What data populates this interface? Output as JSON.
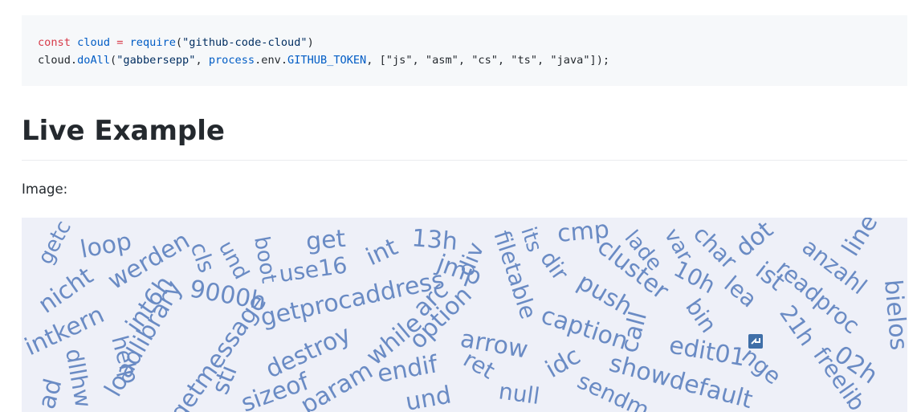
{
  "code": {
    "line1": {
      "kw": "const",
      "var": "cloud",
      "op": "=",
      "fn": "require",
      "open": "(",
      "str": "\"github-code-cloud\"",
      "close": ")"
    },
    "line2": {
      "obj": "cloud",
      "dot": ".",
      "fn": "doAll",
      "open": "(",
      "arg1": "\"gabbersepp\"",
      "comma1": ", ",
      "process": "process",
      "env": ".env.",
      "token": "GITHUB_TOKEN",
      "rest": ", [\"js\", \"asm\", \"cs\", \"ts\", \"java\"]);"
    }
  },
  "section": {
    "title": "Live Example",
    "image_label": "Image:"
  },
  "cloud": {
    "colors": {
      "words": "#6a8bc4",
      "background": "#eef0f8"
    },
    "words": [
      "getc",
      "loop",
      "nicht",
      "werden",
      "cls",
      "und",
      "boot",
      "get",
      "int",
      "13h",
      "div",
      "its",
      "cmp",
      "lade",
      "var",
      "char",
      "dot",
      "anzahl",
      "line",
      "intkern",
      "int6h",
      "9000h",
      "use16",
      "getprocaddress",
      "jmp",
      "filetable",
      "dir",
      "cluster",
      "10h",
      "lea",
      "ist",
      "readproc",
      "bielos",
      "help",
      "loadlibrary",
      "getmessage",
      "sti",
      "destroy",
      "while",
      "arc",
      "option",
      "push",
      "caption",
      "call",
      "bin",
      "21h",
      "dllhw",
      "sizeof",
      "param",
      "endif",
      "arrow",
      "ret",
      "null",
      "idc",
      "showdefault",
      "edit01",
      "nge",
      "freelib",
      "02h",
      "ad",
      "und",
      "sendm"
    ]
  }
}
